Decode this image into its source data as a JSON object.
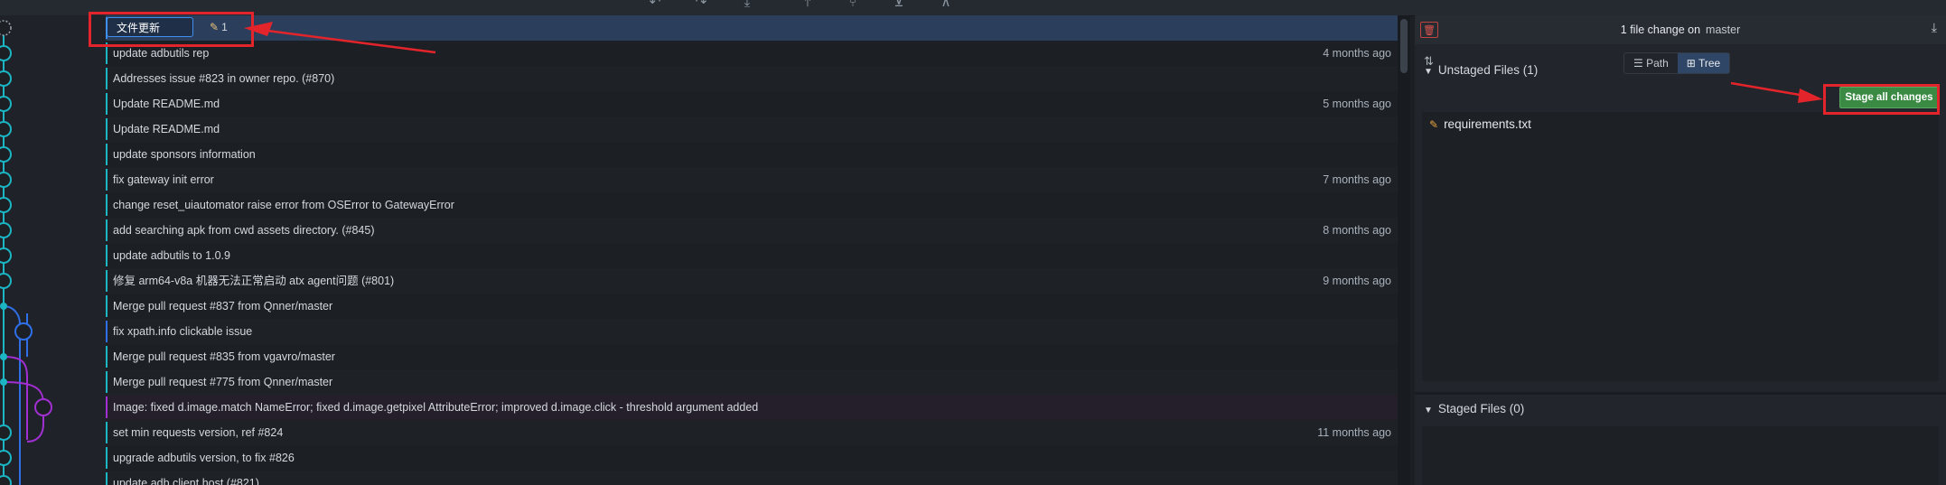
{
  "toolbar": {
    "icons": [
      "undo-icon",
      "redo-icon",
      "pull-icon",
      "push-icon",
      "branch-icon",
      "stash-icon",
      "pop-icon"
    ]
  },
  "edit": {
    "value": "文件更新",
    "change_count": "1"
  },
  "commits": [
    {
      "message": "",
      "time": ""
    },
    {
      "message": "update adbutils rep",
      "time": "4 months ago"
    },
    {
      "message": "Addresses issue #823 in owner repo. (#870)",
      "time": ""
    },
    {
      "message": "Update README.md",
      "time": "5 months ago"
    },
    {
      "message": "Update README.md",
      "time": ""
    },
    {
      "message": "update sponsors information",
      "time": ""
    },
    {
      "message": "fix gateway init error",
      "time": "7 months ago"
    },
    {
      "message": "change reset_uiautomator raise error from OSError to GatewayError",
      "time": ""
    },
    {
      "message": "add searching apk from cwd assets directory. (#845)",
      "time": "8 months ago"
    },
    {
      "message": "update adbutils to 1.0.9",
      "time": ""
    },
    {
      "message": "修复 arm64-v8a 机器无法正常启动 atx agent问题 (#801)",
      "time": "9 months ago"
    },
    {
      "message": "Merge pull request #837 from Qnner/master",
      "time": ""
    },
    {
      "message": "fix xpath.info clickable issue",
      "time": ""
    },
    {
      "message": "Merge pull request #835 from vgavro/master",
      "time": ""
    },
    {
      "message": "Merge pull request #775 from Qnner/master",
      "time": ""
    },
    {
      "message": "Image: fixed d.image.match NameError; fixed d.image.getpixel AttributeError; improved d.image.click - threshold argument added",
      "time": ""
    },
    {
      "message": "set min requests version, ref #824",
      "time": "11 months ago"
    },
    {
      "message": "upgrade adbutils version, to fix #826",
      "time": ""
    },
    {
      "message": "update adb client host (#821)",
      "time": ""
    }
  ],
  "panel": {
    "title": "1 file change on",
    "branch": "master",
    "view_path": "Path",
    "view_tree": "Tree",
    "unstaged_label": "Unstaged Files (1)",
    "stage_all": "Stage all changes",
    "file_name": "requirements.txt",
    "staged_label": "Staged Files (0)"
  },
  "colors": {
    "accent": "#3f8ff0",
    "stage_button": "#3a8a44",
    "annotation": "#e3242b",
    "lane_teal": "#1bb5c4"
  }
}
